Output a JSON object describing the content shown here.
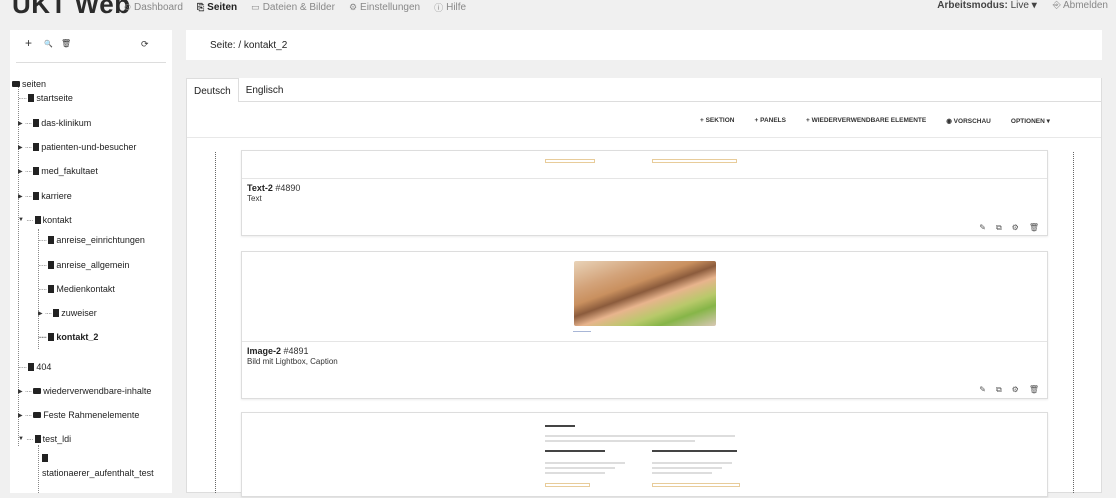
{
  "app": {
    "brand": "UKT Web"
  },
  "nav": [
    {
      "icon": "⏲",
      "label": "Dashboard",
      "active": false
    },
    {
      "icon": "⎘",
      "label": "Seiten",
      "active": true
    },
    {
      "icon": "▭",
      "label": "Dateien & Bilder",
      "active": false
    },
    {
      "icon": "⚙",
      "label": "Einstellungen",
      "active": false
    },
    {
      "icon": "ⓘ",
      "label": "Hilfe",
      "active": false
    }
  ],
  "topright": {
    "mode_label": "Arbeitsmodus:",
    "mode_value": "Live",
    "logout_label": "Abmelden"
  },
  "sidebar": {
    "tools": [
      "+",
      "🔍",
      "🗑",
      "⟳"
    ],
    "tree": {
      "root": "seiten",
      "startseite": "startseite",
      "das_klinikum": "das-klinikum",
      "patienten": "patienten-und-besucher",
      "med_fakultaet": "med_fakultaet",
      "karriere": "karriere",
      "kontakt": "kontakt",
      "anreise_einrichtungen": "anreise_einrichtungen",
      "anreise_allgemein": "anreise_allgemein",
      "medienkontakt": "Medienkontakt",
      "zuweiser": "zuweiser",
      "kontakt_2": "kontakt_2",
      "n404": "404",
      "wiederverwendbare": "wiederverwendbare-inhalte",
      "feste": "Feste Rahmenelemente",
      "test_ldi": "test_ldi",
      "stationaer": "stationaerer_aufenthalt_test"
    }
  },
  "breadcrumb": {
    "label": "Seite:",
    "path": "/ kontakt_2"
  },
  "tabs": [
    {
      "label": "Deutsch",
      "active": true
    },
    {
      "label": "Englisch",
      "active": false
    }
  ],
  "actions": [
    "+ SEKTION",
    "+ PANELS",
    "+ WIEDERVERWENDBARE ELEMENTE",
    "◉ VORSCHAU",
    "OPTIONEN ▾"
  ],
  "elements": [
    {
      "name": "Text-2",
      "id": "#4890",
      "desc": "Text"
    },
    {
      "name": "Image-2",
      "id": "#4891",
      "desc": "Bild mit Lightbox, Caption"
    }
  ],
  "card_tools": [
    "✎",
    "⧉",
    "⚙",
    "🗑"
  ],
  "colors": {
    "caption": "#8a9bc0",
    "mini_button_border": "#e8cc9a"
  }
}
